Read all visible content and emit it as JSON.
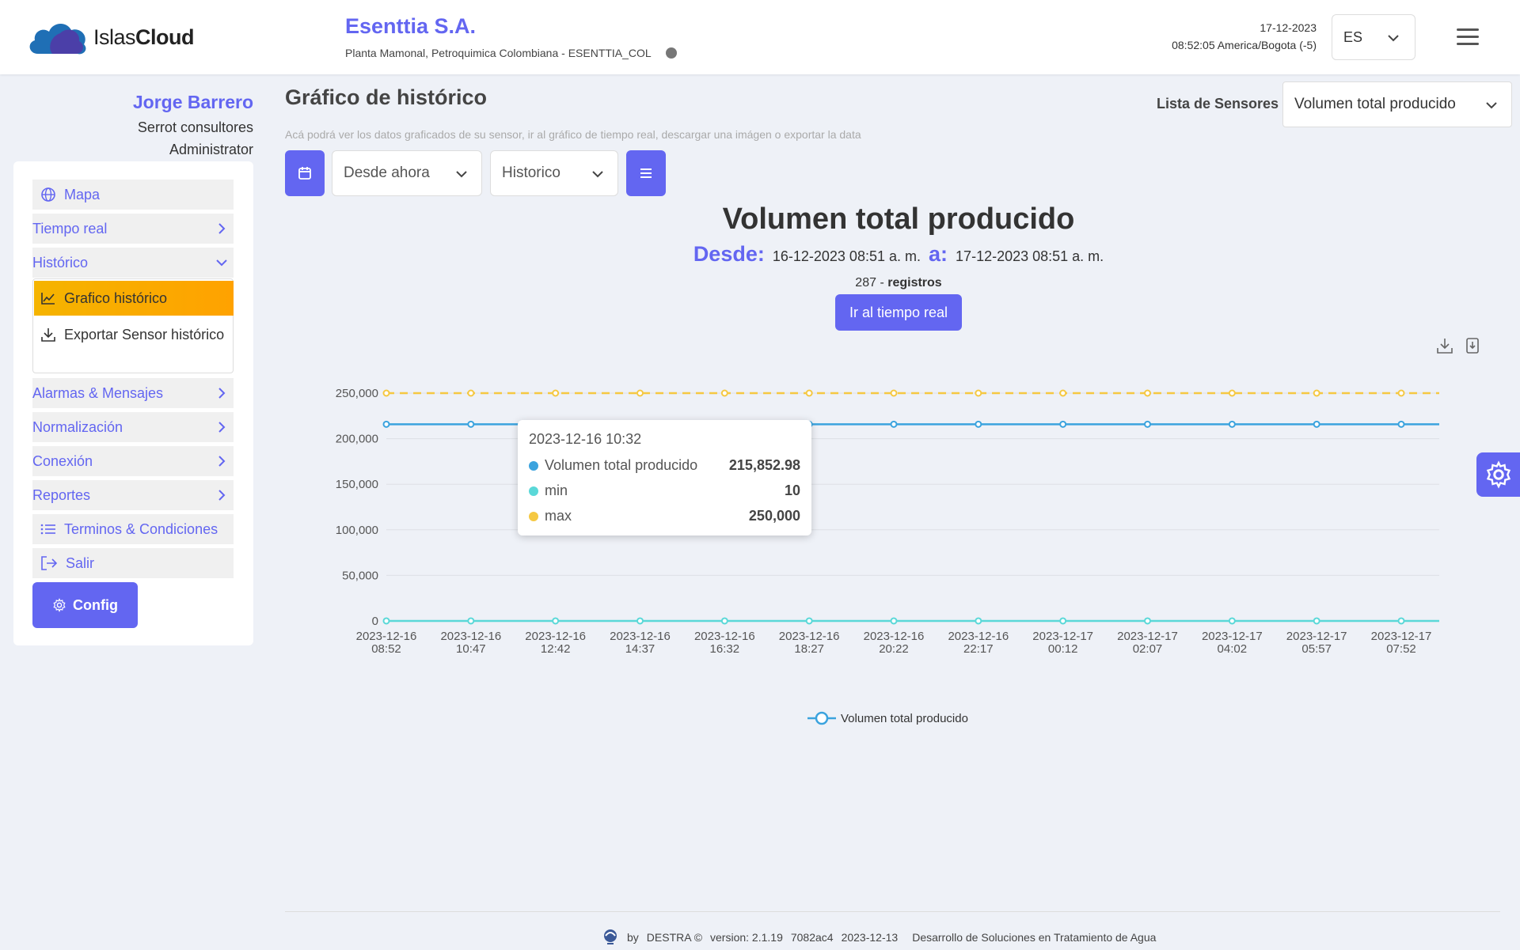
{
  "header": {
    "logo_text_light": "Islas",
    "logo_text_bold": "Cloud",
    "company": "Esenttia S.A.",
    "plant": "Planta Mamonal, Petroquimica Colombiana - ESENTTIA_COL",
    "date": "17-12-2023",
    "time": "08:52:05 America/Bogota (-5)",
    "language": "ES"
  },
  "user": {
    "name": "Jorge Barrero",
    "company": "Serrot consultores",
    "role": "Administrator"
  },
  "sidebar": {
    "items": [
      {
        "label": "Mapa"
      },
      {
        "label": "Tiempo real"
      },
      {
        "label": "Histórico"
      },
      {
        "label": "Alarmas & Mensajes"
      },
      {
        "label": "Normalización"
      },
      {
        "label": "Conexión"
      },
      {
        "label": "Reportes"
      },
      {
        "label": "Terminos & Condiciones"
      },
      {
        "label": "Salir"
      }
    ],
    "submenu": {
      "active": "Grafico histórico",
      "export": "Exportar Sensor histórico"
    },
    "config": "Config"
  },
  "main": {
    "title": "Gráfico de histórico",
    "description": "Acá podrá ver los datos graficados de su sensor, ir al gráfico de tiempo real, descargar una imágen o exportar la data",
    "sensor_label": "Lista de Sensores",
    "sensor_selected": "Volumen total producido",
    "range_from": "Desde ahora",
    "mode": "Historico",
    "chart_title": "Volumen total producido",
    "desde_label": "Desde:",
    "desde_value": "16-12-2023 08:51 a. m.",
    "a_label": "a:",
    "a_value": "17-12-2023 08:51 a. m.",
    "records_count": "287 -",
    "records_label": "registros",
    "realtime_button": "Ir al tiempo real"
  },
  "tooltip": {
    "title": "2023-12-16 10:32",
    "rows": [
      {
        "label": "Volumen total producido",
        "value": "215,852.98",
        "color": "#3ba3de"
      },
      {
        "label": "min",
        "value": "10",
        "color": "#5ad8d8"
      },
      {
        "label": "max",
        "value": "250,000",
        "color": "#f5c842"
      }
    ]
  },
  "chart_data": {
    "type": "line",
    "categories": [
      "2023-12-16 08:52",
      "2023-12-16 10:47",
      "2023-12-16 12:42",
      "2023-12-16 14:37",
      "2023-12-16 16:32",
      "2023-12-16 18:27",
      "2023-12-16 20:22",
      "2023-12-16 22:17",
      "2023-12-17 00:12",
      "2023-12-17 02:07",
      "2023-12-17 04:02",
      "2023-12-17 05:57",
      "2023-12-17 07:52"
    ],
    "y_ticks": [
      "0",
      "50,000",
      "100,000",
      "150,000",
      "200,000",
      "250,000"
    ],
    "ylim": [
      0,
      250000
    ],
    "series": [
      {
        "name": "Volumen total producido",
        "color": "#3ba3de",
        "values": [
          215852.98,
          215852.98,
          215852.98,
          215852.98,
          215852.98,
          215852.98,
          215852.98,
          215852.98,
          215852.98,
          215852.98,
          215852.98,
          215852.98,
          215852.98
        ]
      },
      {
        "name": "min",
        "color": "#5ad8d8",
        "values": [
          10,
          10,
          10,
          10,
          10,
          10,
          10,
          10,
          10,
          10,
          10,
          10,
          10
        ]
      },
      {
        "name": "max",
        "color": "#f5c842",
        "dashed": true,
        "values": [
          250000,
          250000,
          250000,
          250000,
          250000,
          250000,
          250000,
          250000,
          250000,
          250000,
          250000,
          250000,
          250000
        ]
      }
    ],
    "legend": [
      "Volumen total producido"
    ],
    "legend_position": "bottom-center",
    "grid": true
  },
  "footer": {
    "by": "by",
    "brand": "DESTRA ©",
    "version": "version: 2.1.19",
    "commit": "7082ac4",
    "date": "2023-12-13",
    "tagline": "Desarrollo de Soluciones en Tratamiento de Agua"
  }
}
